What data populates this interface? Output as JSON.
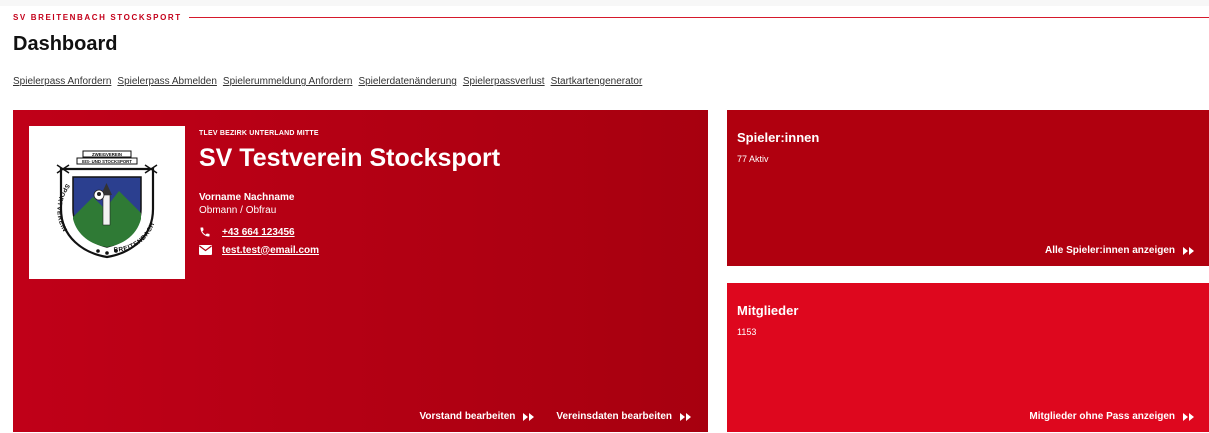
{
  "header": {
    "org_name": "SV BREITENBACH STOCKSPORT",
    "page_title": "Dashboard"
  },
  "nav": {
    "links": [
      "Spielerpass Anfordern",
      "Spielerpass Abmelden",
      "Spielerummeldung Anfordern",
      "Spielerdatenänderung",
      "Spielerpassverlust",
      "Startkartengenerator"
    ]
  },
  "club": {
    "district": "TLEV BEZIRK UNTERLAND MITTE",
    "name": "SV Testverein Stocksport",
    "contact_name": "Vorname Nachname",
    "contact_role": "Obmann / Obfrau",
    "phone": "+43 664 123456",
    "email": "test.test@email.com",
    "logo": {
      "top_text_1": "ZWEIGVEREIN",
      "top_text_2": "EIS- UND STOCKSPORT",
      "ring_left": "SPORTVEREIN",
      "ring_right": "BREITENBACH"
    },
    "actions": {
      "edit_board": "Vorstand bearbeiten",
      "edit_club_data": "Vereinsdaten bearbeiten"
    }
  },
  "players": {
    "title": "Spieler:innen",
    "value": "77 Aktiv",
    "link": "Alle Spieler:innen anzeigen"
  },
  "members": {
    "title": "Mitglieder",
    "value": "1153",
    "link": "Mitglieder ohne Pass anzeigen"
  },
  "colors": {
    "brand_red": "#c4001a",
    "card_dark_red": "#b0000f",
    "card_bright_red": "#de071e"
  }
}
